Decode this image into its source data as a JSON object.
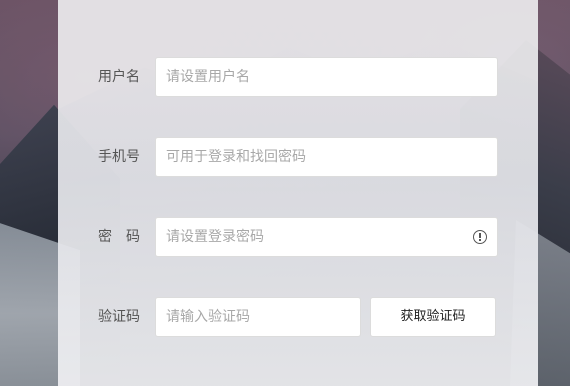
{
  "form": {
    "username": {
      "label": "用户名",
      "placeholder": "请设置用户名",
      "value": ""
    },
    "phone": {
      "label": "手机号",
      "placeholder": "可用于登录和找回密码",
      "value": ""
    },
    "password": {
      "label": "密　码",
      "placeholder": "请设置登录密码",
      "value": "",
      "icon": "info-circle-icon"
    },
    "verification": {
      "label": "验证码",
      "placeholder": "请输入验证码",
      "value": "",
      "button_label": "获取验证码"
    }
  },
  "colors": {
    "panel_bg": "#eeeef1",
    "input_border": "#dcdcdc",
    "label_text": "#555555",
    "placeholder_text": "#a8a8a8"
  }
}
